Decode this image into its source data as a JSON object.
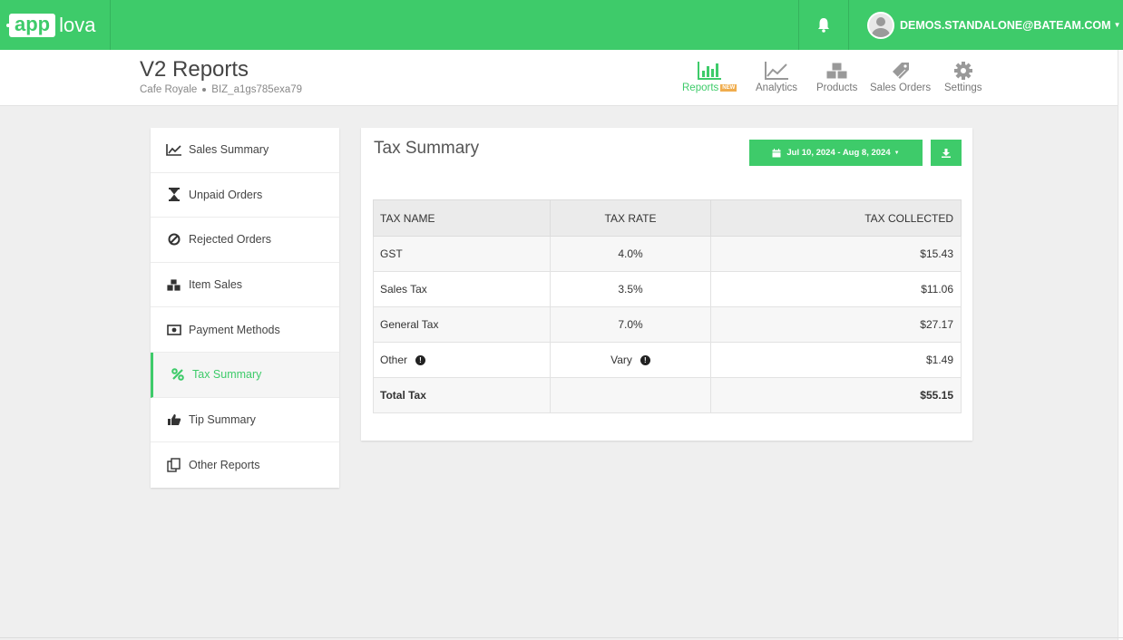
{
  "topbar": {
    "logo_app": "app",
    "logo_lova": "lova",
    "user_email": "DEMOS.STANDALONE@BATEAM.COM",
    "bg_color": "#3ecb6a"
  },
  "header": {
    "title": "V2 Reports",
    "business_name": "Cafe Royale",
    "business_id": "BIZ_a1gs785exa79",
    "nav": [
      {
        "label": "Reports",
        "badge": "NEW",
        "icon": "bar-chart-icon",
        "active": true
      },
      {
        "label": "Analytics",
        "icon": "line-chart-icon"
      },
      {
        "label": "Products",
        "icon": "cubes-icon"
      },
      {
        "label": "Sales Orders",
        "icon": "tag-icon"
      },
      {
        "label": "Settings",
        "icon": "gear-icon"
      }
    ]
  },
  "sidebar": {
    "items": [
      {
        "label": "Sales Summary",
        "icon": "line-chart-icon"
      },
      {
        "label": "Unpaid Orders",
        "icon": "hourglass-icon"
      },
      {
        "label": "Rejected Orders",
        "icon": "ban-icon"
      },
      {
        "label": "Item Sales",
        "icon": "cubes-icon"
      },
      {
        "label": "Payment Methods",
        "icon": "money-icon"
      },
      {
        "label": "Tax Summary",
        "icon": "percent-icon",
        "active": true
      },
      {
        "label": "Tip Summary",
        "icon": "thumbs-up-icon"
      },
      {
        "label": "Other Reports",
        "icon": "copy-icon"
      }
    ]
  },
  "panel": {
    "title": "Tax Summary",
    "date_range": "Jul 10, 2024 - Aug 8, 2024",
    "table": {
      "headers": [
        "TAX NAME",
        "TAX RATE",
        "TAX COLLECTED"
      ],
      "rows": [
        {
          "name": "GST",
          "rate": "4.0%",
          "collected": "$15.43"
        },
        {
          "name": "Sales Tax",
          "rate": "3.5%",
          "collected": "$11.06"
        },
        {
          "name": "General Tax",
          "rate": "7.0%",
          "collected": "$27.17"
        },
        {
          "name": "Other",
          "rate": "Vary",
          "collected": "$1.49"
        }
      ],
      "total": {
        "name": "Total Tax",
        "rate": "",
        "collected": "$55.15"
      }
    }
  },
  "colors": {
    "accent": "#3ecb6a",
    "badge": "#f0ad4e"
  }
}
